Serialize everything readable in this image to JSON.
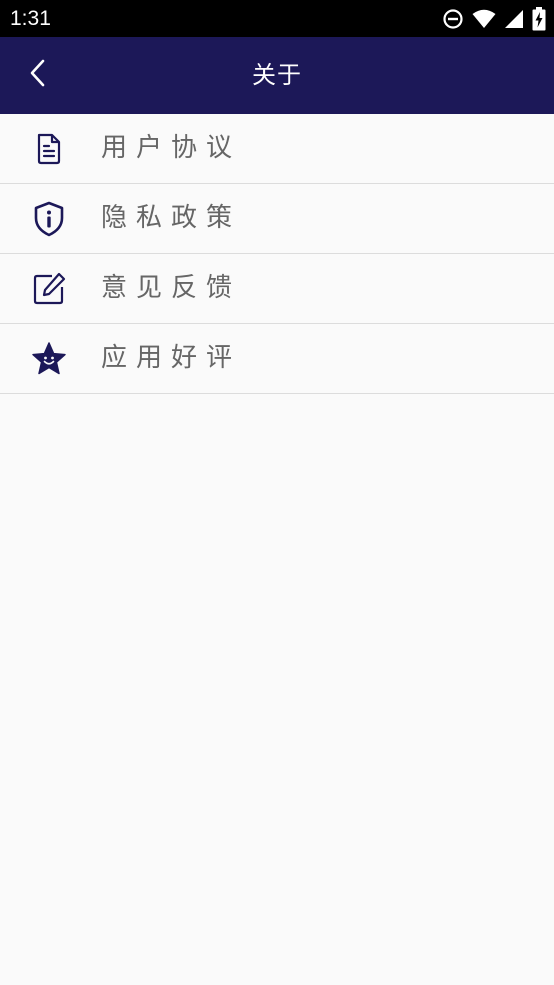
{
  "status_bar": {
    "time": "1:31",
    "icons": [
      "do-not-disturb-icon",
      "wifi-icon",
      "signal-icon",
      "battery-charging-icon"
    ]
  },
  "header": {
    "back_icon": "chevron-left-icon",
    "title": "关于"
  },
  "menu": {
    "items": [
      {
        "label": "用户协议",
        "icon": "document-icon"
      },
      {
        "label": "隐私政策",
        "icon": "shield-info-icon"
      },
      {
        "label": "意见反馈",
        "icon": "edit-icon"
      },
      {
        "label": "应用好评",
        "icon": "star-icon"
      }
    ]
  },
  "colors": {
    "app_bar": "#1c1858",
    "icon": "#1c1858",
    "label": "#666666",
    "background": "#fafafa",
    "divider": "#dcdcdc"
  }
}
